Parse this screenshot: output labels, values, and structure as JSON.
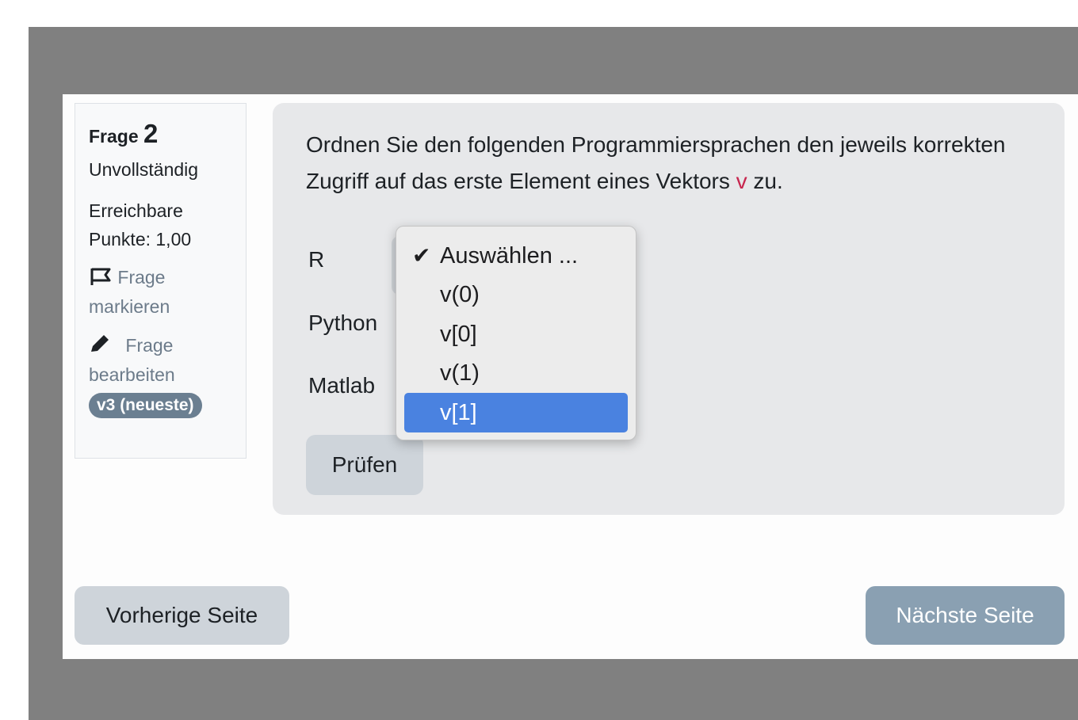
{
  "info": {
    "question_label": "Frage",
    "question_number": "2",
    "state": "Unvollständig",
    "grade_line1": "Erreichbare",
    "grade_line2": "Punkte: 1,00",
    "flag_line1": "Frage",
    "flag_line2": "markieren",
    "edit_line1": "Frage",
    "edit_line2": "bearbeiten",
    "version_badge": "v3 (neueste)"
  },
  "question": {
    "text_part1": "Ordnen Sie den folgenden Programmiersprachen den jeweils korrekten Zugriff auf das erste Element eines Vektors ",
    "code": "v",
    "text_part2": " zu.",
    "rows": [
      {
        "label": "R"
      },
      {
        "label": "Python"
      },
      {
        "label": "Matlab"
      }
    ],
    "check_button": "Prüfen"
  },
  "dropdown": {
    "options": [
      "Auswählen ...",
      "v(0)",
      "v[0]",
      "v(1)",
      "v[1]"
    ],
    "selected_index": 0,
    "highlighted_index": 4
  },
  "navigation": {
    "prev": "Vorherige Seite",
    "next": "Nächste Seite"
  },
  "colors": {
    "backdrop": "#808080",
    "highlight": "#4a82e0",
    "code": "#c7254e",
    "badge": "#6b7f91",
    "next_button": "#8aa0b2"
  }
}
